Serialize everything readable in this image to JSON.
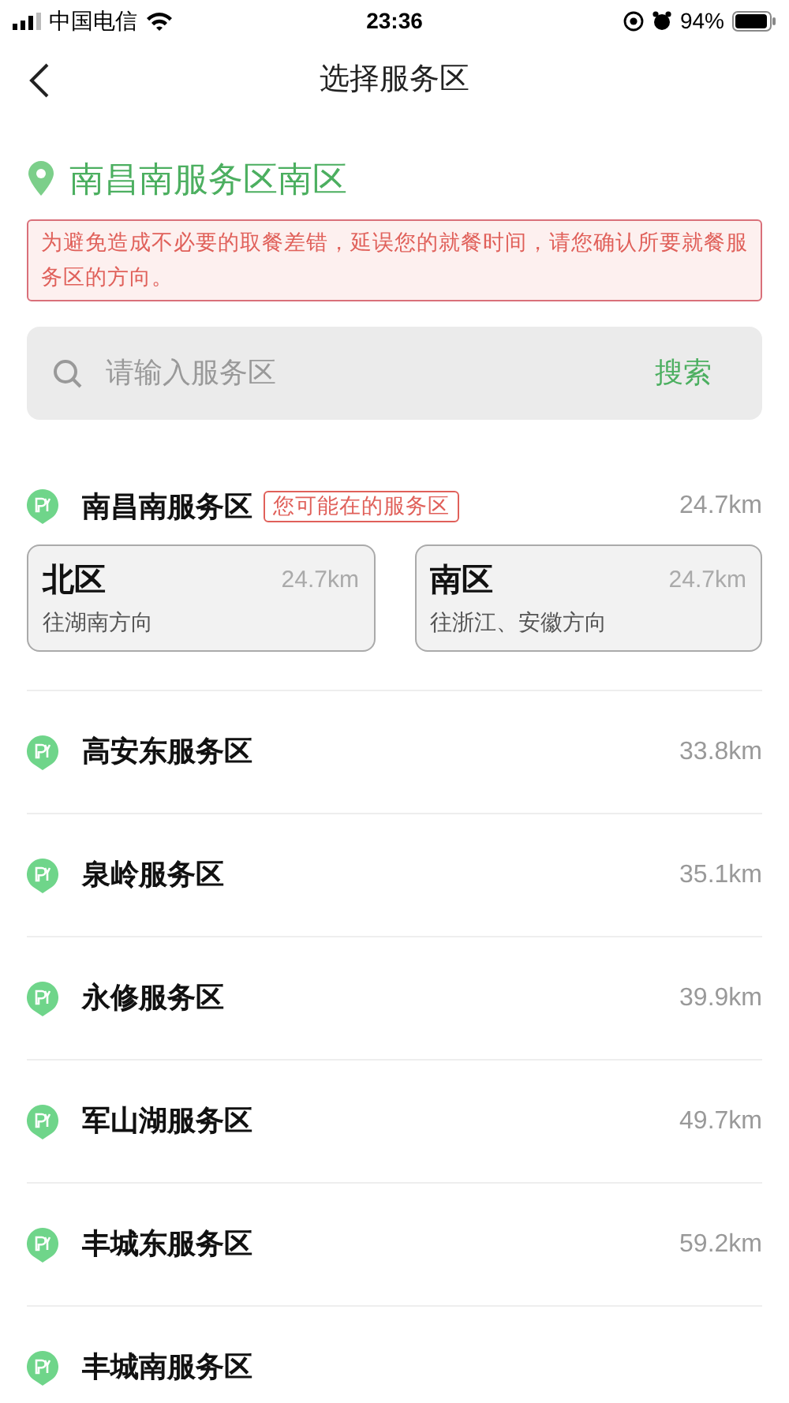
{
  "status_bar": {
    "carrier": "中国电信",
    "time": "23:36",
    "battery": "94%"
  },
  "header": {
    "title": "选择服务区"
  },
  "current": {
    "name": "南昌南服务区南区"
  },
  "notice": "为避免造成不必要的取餐差错，延误您的就餐时间，请您确认所要就餐服务区的方向。",
  "search": {
    "placeholder": "请输入服务区",
    "button": "搜索"
  },
  "stations": [
    {
      "name": "南昌南服务区",
      "badge": "您可能在的服务区",
      "distance": "24.7km",
      "zones": [
        {
          "name": "北区",
          "distance": "24.7km",
          "direction": "往湖南方向"
        },
        {
          "name": "南区",
          "distance": "24.7km",
          "direction": "往浙江、安徽方向"
        }
      ]
    },
    {
      "name": "高安东服务区",
      "distance": "33.8km"
    },
    {
      "name": "泉岭服务区",
      "distance": "35.1km"
    },
    {
      "name": "永修服务区",
      "distance": "39.9km"
    },
    {
      "name": "军山湖服务区",
      "distance": "49.7km"
    },
    {
      "name": "丰城东服务区",
      "distance": "59.2km"
    },
    {
      "name": "丰城南服务区"
    }
  ]
}
